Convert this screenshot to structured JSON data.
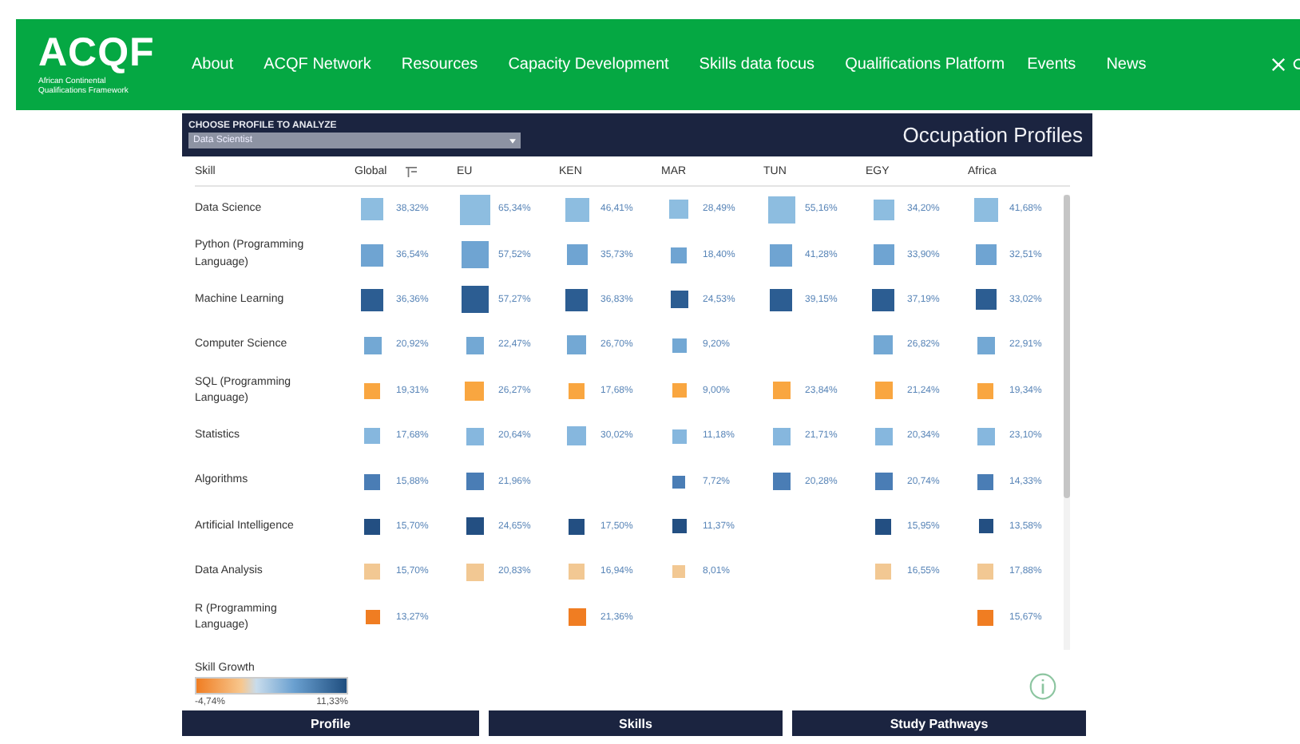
{
  "site": {
    "logo": "ACQF",
    "logo_subtitle": "African Continental Qualifications Framework",
    "nav": [
      "About",
      "ACQF Network",
      "Resources",
      "Capacity Development",
      "Skills data focus",
      "Qualifications Platform",
      "Events",
      "News"
    ]
  },
  "dashboard": {
    "picker_label": "CHOOSE PROFILE TO ANALYZE",
    "picker_value": "Data Scientist",
    "title": "Occupation Profiles",
    "columns": [
      "Skill",
      "Global",
      "EU",
      "KEN",
      "MAR",
      "TUN",
      "EGY",
      "Africa"
    ],
    "rows": [
      {
        "skill": "Data Science",
        "cells": [
          {
            "value": "38,32%",
            "color": "#8dbde0"
          },
          {
            "value": "65,34%",
            "color": "#8dbde0"
          },
          {
            "value": "46,41%",
            "color": "#8dbde0"
          },
          {
            "value": "28,49%",
            "color": "#8dbde0"
          },
          {
            "value": "55,16%",
            "color": "#8dbde0"
          },
          {
            "value": "34,20%",
            "color": "#8dbde0"
          },
          {
            "value": "41,68%",
            "color": "#8dbde0"
          }
        ]
      },
      {
        "skill": "Python (Programming Language)",
        "cells": [
          {
            "value": "36,54%",
            "color": "#6fa4d2"
          },
          {
            "value": "57,52%",
            "color": "#6fa4d2"
          },
          {
            "value": "35,73%",
            "color": "#6fa4d2"
          },
          {
            "value": "18,40%",
            "color": "#6fa4d2"
          },
          {
            "value": "41,28%",
            "color": "#6fa4d2"
          },
          {
            "value": "33,90%",
            "color": "#6fa4d2"
          },
          {
            "value": "32,51%",
            "color": "#6fa4d2"
          }
        ]
      },
      {
        "skill": "Machine Learning",
        "cells": [
          {
            "value": "36,36%",
            "color": "#2c5d92"
          },
          {
            "value": "57,27%",
            "color": "#2c5d92"
          },
          {
            "value": "36,83%",
            "color": "#2c5d92"
          },
          {
            "value": "24,53%",
            "color": "#2c5d92"
          },
          {
            "value": "39,15%",
            "color": "#2c5d92"
          },
          {
            "value": "37,19%",
            "color": "#2c5d92"
          },
          {
            "value": "33,02%",
            "color": "#2c5d92"
          }
        ]
      },
      {
        "skill": "Computer Science",
        "cells": [
          {
            "value": "20,92%",
            "color": "#73a8d4"
          },
          {
            "value": "22,47%",
            "color": "#73a8d4"
          },
          {
            "value": "26,70%",
            "color": "#73a8d4"
          },
          {
            "value": "9,20%",
            "color": "#73a8d4"
          },
          null,
          {
            "value": "26,82%",
            "color": "#73a8d4"
          },
          {
            "value": "22,91%",
            "color": "#73a8d4"
          }
        ]
      },
      {
        "skill": "SQL (Programming Language)",
        "cells": [
          {
            "value": "19,31%",
            "color": "#f9a640"
          },
          {
            "value": "26,27%",
            "color": "#f9a640"
          },
          {
            "value": "17,68%",
            "color": "#f9a640"
          },
          {
            "value": "9,00%",
            "color": "#f9a640"
          },
          {
            "value": "23,84%",
            "color": "#f9a640"
          },
          {
            "value": "21,24%",
            "color": "#f9a640"
          },
          {
            "value": "19,34%",
            "color": "#f9a640"
          }
        ]
      },
      {
        "skill": "Statistics",
        "cells": [
          {
            "value": "17,68%",
            "color": "#86b7de"
          },
          {
            "value": "20,64%",
            "color": "#86b7de"
          },
          {
            "value": "30,02%",
            "color": "#86b7de"
          },
          {
            "value": "11,18%",
            "color": "#86b7de"
          },
          {
            "value": "21,71%",
            "color": "#86b7de"
          },
          {
            "value": "20,34%",
            "color": "#86b7de"
          },
          {
            "value": "23,10%",
            "color": "#86b7de"
          }
        ]
      },
      {
        "skill": "Algorithms",
        "cells": [
          {
            "value": "15,88%",
            "color": "#4a7db5"
          },
          {
            "value": "21,96%",
            "color": "#4a7db5"
          },
          null,
          {
            "value": "7,72%",
            "color": "#4a7db5"
          },
          {
            "value": "20,28%",
            "color": "#4a7db5"
          },
          {
            "value": "20,74%",
            "color": "#4a7db5"
          },
          {
            "value": "14,33%",
            "color": "#4a7db5"
          }
        ]
      },
      {
        "skill": "Artificial Intelligence",
        "cells": [
          {
            "value": "15,70%",
            "color": "#234f82"
          },
          {
            "value": "24,65%",
            "color": "#234f82"
          },
          {
            "value": "17,50%",
            "color": "#234f82"
          },
          {
            "value": "11,37%",
            "color": "#234f82"
          },
          null,
          {
            "value": "15,95%",
            "color": "#234f82"
          },
          {
            "value": "13,58%",
            "color": "#234f82"
          }
        ]
      },
      {
        "skill": "Data Analysis",
        "cells": [
          {
            "value": "15,70%",
            "color": "#f2c893"
          },
          {
            "value": "20,83%",
            "color": "#f2c893"
          },
          {
            "value": "16,94%",
            "color": "#f2c893"
          },
          {
            "value": "8,01%",
            "color": "#f2c893"
          },
          null,
          {
            "value": "16,55%",
            "color": "#f2c893"
          },
          {
            "value": "17,88%",
            "color": "#f2c893"
          }
        ]
      },
      {
        "skill": "R (Programming Language)",
        "cells": [
          {
            "value": "13,27%",
            "color": "#f07d22"
          },
          null,
          {
            "value": "21,36%",
            "color": "#f07d22"
          },
          null,
          null,
          null,
          {
            "value": "15,67%",
            "color": "#f07d22"
          }
        ]
      }
    ],
    "legend": {
      "title": "Skill Growth",
      "min": "-4,74%",
      "max": "11,33%"
    },
    "buttons": [
      "Profile",
      "Skills",
      "Study Pathways"
    ]
  }
}
